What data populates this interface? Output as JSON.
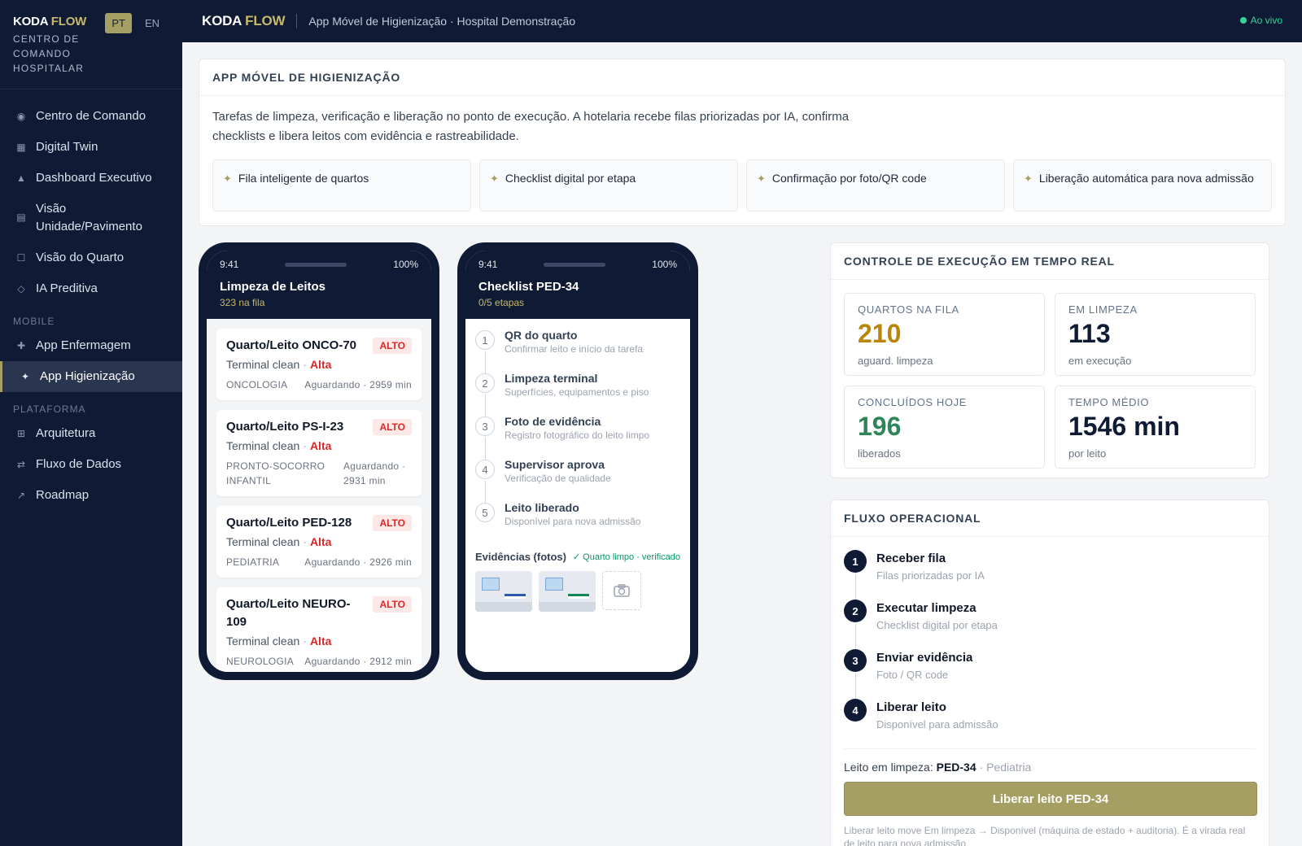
{
  "brand": {
    "koda": "KODA",
    "flow": "FLOW",
    "subtitle": "CENTRO DE COMANDO HOSPITALAR"
  },
  "lang": {
    "pt": "PT",
    "en": "EN"
  },
  "sidebar": {
    "items_top": [
      {
        "icon": "target-icon",
        "label": "Centro de Comando"
      },
      {
        "icon": "grid-icon",
        "label": "Digital Twin"
      },
      {
        "icon": "triangle-icon",
        "label": "Dashboard Executivo"
      },
      {
        "icon": "layers-icon",
        "label": "Visão Unidade/Pavimento"
      },
      {
        "icon": "square-icon",
        "label": "Visão do Quarto"
      },
      {
        "icon": "diamond-icon",
        "label": "IA Preditiva"
      }
    ],
    "mobile_title": "MOBILE",
    "items_mobile": [
      {
        "icon": "plus-icon",
        "label": "App Enfermagem"
      },
      {
        "icon": "sparkle-icon",
        "label": "App Higienização"
      }
    ],
    "platform_title": "PLATAFORMA",
    "items_platform": [
      {
        "icon": "grid-icon",
        "label": "Arquitetura"
      },
      {
        "icon": "arrows-icon",
        "label": "Fluxo de Dados"
      },
      {
        "icon": "trend-arrow-icon",
        "label": "Roadmap"
      }
    ]
  },
  "topbar": {
    "koda": "KODA",
    "flow": "FLOW",
    "crumb": "App Móvel de Higienização · Hospital Demonstração",
    "live": "Ao vivo"
  },
  "intro": {
    "title": "APP MÓVEL DE HIGIENIZAÇÃO",
    "text": "Tarefas de limpeza, verificação e liberação no ponto de execução. A hotelaria recebe filas priorizadas por IA, confirma checklists e libera leitos com evidência e rastreabilidade.",
    "features": [
      "Fila inteligente de quartos",
      "Checklist digital por etapa",
      "Confirmação por foto/QR code",
      "Liberação automática para nova admissão"
    ]
  },
  "phone1": {
    "time": "9:41",
    "battery": "100%",
    "title": "Limpeza de Leitos",
    "subtitle": "323 na fila",
    "tasks": [
      {
        "title": "Quarto/Leito ONCO-70",
        "badge": "ALTO",
        "type": "Terminal clean",
        "priority": "Alta",
        "dept": "ONCOLOGIA",
        "wait": "Aguardando · 2959 min"
      },
      {
        "title": "Quarto/Leito PS-I-23",
        "badge": "ALTO",
        "type": "Terminal clean",
        "priority": "Alta",
        "dept": "PRONTO-SOCORRO INFANTIL",
        "wait": "Aguardando · 2931 min"
      },
      {
        "title": "Quarto/Leito PED-128",
        "badge": "ALTO",
        "type": "Terminal clean",
        "priority": "Alta",
        "dept": "PEDIATRIA",
        "wait": "Aguardando · 2926 min"
      },
      {
        "title": "Quarto/Leito NEURO-109",
        "badge": "ALTO",
        "type": "Terminal clean",
        "priority": "Alta",
        "dept": "NEUROLOGIA",
        "wait": "Aguardando · 2912 min"
      }
    ]
  },
  "phone2": {
    "time": "9:41",
    "battery": "100%",
    "title": "Checklist PED-34",
    "subtitle": "0/5 etapas",
    "steps": [
      {
        "n": "1",
        "title": "QR do quarto",
        "desc": "Confirmar leito e início da tarefa"
      },
      {
        "n": "2",
        "title": "Limpeza terminal",
        "desc": "Superfícies, equipamentos e piso"
      },
      {
        "n": "3",
        "title": "Foto de evidência",
        "desc": "Registro fotográfico do leito limpo"
      },
      {
        "n": "4",
        "title": "Supervisor aprova",
        "desc": "Verificação de qualidade"
      },
      {
        "n": "5",
        "title": "Leito liberado",
        "desc": "Disponível para nova admissão"
      }
    ],
    "evidence_title": "Evidências (fotos)",
    "evidence_status": "✓ Quarto limpo · verificado"
  },
  "kpis": {
    "title": "CONTROLE DE EXECUÇÃO EM TEMPO REAL",
    "items": [
      {
        "label": "QUARTOS NA FILA",
        "value": "210",
        "sub": "aguard. limpeza",
        "color": "#b8860b"
      },
      {
        "label": "EM LIMPEZA",
        "value": "113",
        "sub": "em execução",
        "color": "#0f1b35"
      },
      {
        "label": "CONCLUÍDOS HOJE",
        "value": "196",
        "sub": "liberados",
        "color": "#2f855a"
      },
      {
        "label": "TEMPO MÉDIO",
        "value": "1546 min",
        "sub": "por leito",
        "color": "#0f1b35"
      }
    ]
  },
  "flow": {
    "title": "FLUXO OPERACIONAL",
    "steps": [
      {
        "n": "1",
        "title": "Receber fila",
        "desc": "Filas priorizadas por IA"
      },
      {
        "n": "2",
        "title": "Executar limpeza",
        "desc": "Checklist digital por etapa"
      },
      {
        "n": "3",
        "title": "Enviar evidência",
        "desc": "Foto / QR code"
      },
      {
        "n": "4",
        "title": "Liberar leito",
        "desc": "Disponível para admissão"
      }
    ],
    "bed_label": "Leito em limpeza:",
    "bed_id": "PED-34",
    "bed_unit": "· Pediatria",
    "button": "Liberar leito PED-34",
    "note": "Liberar leito move Em limpeza → Disponível (máquina de estado + auditoria). É a virada real de leito para nova admissão."
  }
}
